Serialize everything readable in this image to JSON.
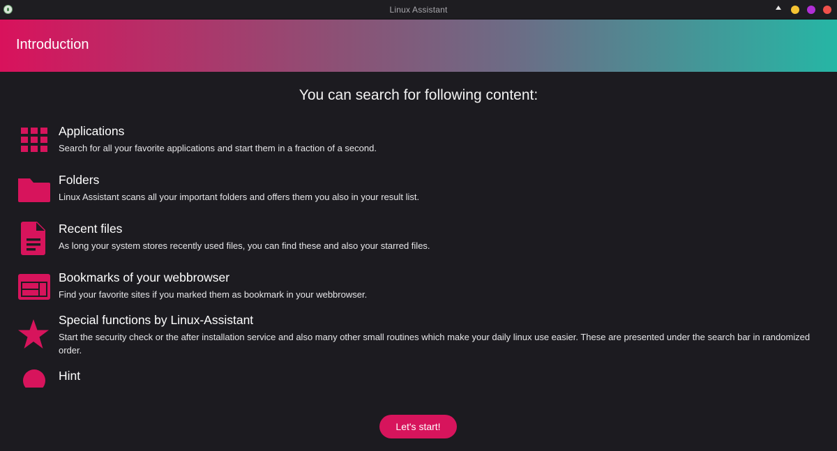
{
  "window": {
    "title": "Linux Assistant",
    "controls": {
      "up_color": "#e8e8e8",
      "minimize_color": "#f5c333",
      "maximize_color": "#b12fd6",
      "close_color": "#f0504b"
    }
  },
  "header": {
    "title": "Introduction",
    "gradient": [
      "#d9125c",
      "#8d5075",
      "#6b6d86",
      "#26b6a5"
    ]
  },
  "main": {
    "heading": "You can search for following content:",
    "items": [
      {
        "icon": "apps-grid-icon",
        "title": "Applications",
        "description": "Search for all your favorite applications and start them in a fraction of a second."
      },
      {
        "icon": "folder-icon",
        "title": "Folders",
        "description": "Linux Assistant scans all your important folders and offers them you also in your result list."
      },
      {
        "icon": "document-icon",
        "title": "Recent files",
        "description": "As long your system stores recently used files, you can find these and also your starred files."
      },
      {
        "icon": "browser-window-icon",
        "title": "Bookmarks of your webbrowser",
        "description": "Find your favorite sites if you marked them as bookmark in your webbrowser."
      },
      {
        "icon": "star-icon",
        "title": "Special functions by Linux-Assistant",
        "description": "Start the security check or the after installation service and also many other small routines which make your daily linux use easier. These are presented under the search bar in randomized order."
      },
      {
        "icon": "lightbulb-icon",
        "title": "Hint",
        "description": ""
      }
    ]
  },
  "footer": {
    "start_label": "Let's start!"
  },
  "colors": {
    "accent": "#d7145c",
    "background": "#1c1b20",
    "text": "#ffffff"
  }
}
